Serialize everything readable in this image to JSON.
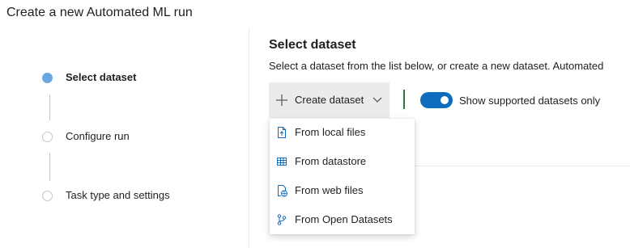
{
  "page": {
    "title": "Create a new Automated ML run"
  },
  "stepper": {
    "steps": [
      {
        "label": "Select dataset",
        "state": "active"
      },
      {
        "label": "Configure run",
        "state": "pending"
      },
      {
        "label": "Task type and settings",
        "state": "pending"
      }
    ]
  },
  "main": {
    "section_title": "Select dataset",
    "description": "Select a dataset from the list below, or create a new dataset. Automated"
  },
  "toolbar": {
    "create_dataset_label": "Create dataset",
    "create_dataset_icon": "plus-icon",
    "dropdown_icon": "chevron-down-icon",
    "toggle_label": "Show supported datasets only",
    "toggle_on": true,
    "accent_color": "#0f6cbd"
  },
  "create_menu": {
    "items": [
      {
        "label": "From local files",
        "icon": "file-upload-icon"
      },
      {
        "label": "From datastore",
        "icon": "table-icon"
      },
      {
        "label": "From web files",
        "icon": "web-file-icon"
      },
      {
        "label": "From Open Datasets",
        "icon": "branch-icon"
      }
    ]
  }
}
